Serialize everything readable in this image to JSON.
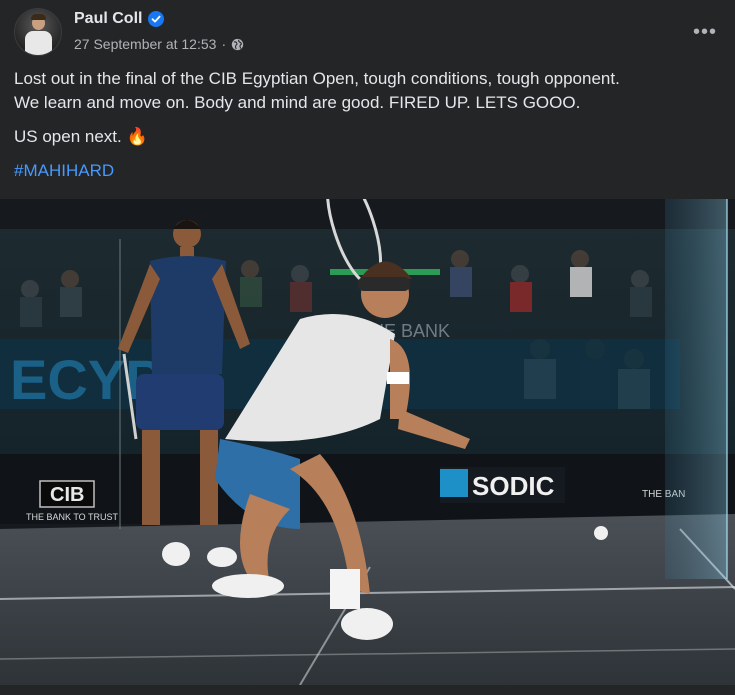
{
  "post": {
    "author": "Paul Coll",
    "timestamp": "27 September at 12:53",
    "separator": "·",
    "more_label": "•••",
    "text_line1": "Lost out in the final of the CIB Egyptian Open, tough conditions, tough opponent.",
    "text_line2": "We learn and move on. Body and mind are good. FIRED UP. LETS GOOO.",
    "text_line3": "US open next.",
    "emoji": "🔥",
    "hashtag": "#MAHIHARD"
  },
  "photo": {
    "banner_text": "THE BANK",
    "sponsor_left": "CIB",
    "sponsor_left_tag": "THE BANK TO TRUST",
    "sponsor_center": "SODIC",
    "sponsor_right": "THE BAN",
    "background_big_text": "ECYPT"
  },
  "icons": {
    "verified": "verified-badge-icon",
    "privacy": "globe-icon",
    "menu": "more-options-icon"
  },
  "colors": {
    "card_bg": "#242526",
    "text_primary": "#e4e6eb",
    "text_secondary": "#b0b3b8",
    "link": "#4599ff",
    "verified": "#1877f2"
  }
}
